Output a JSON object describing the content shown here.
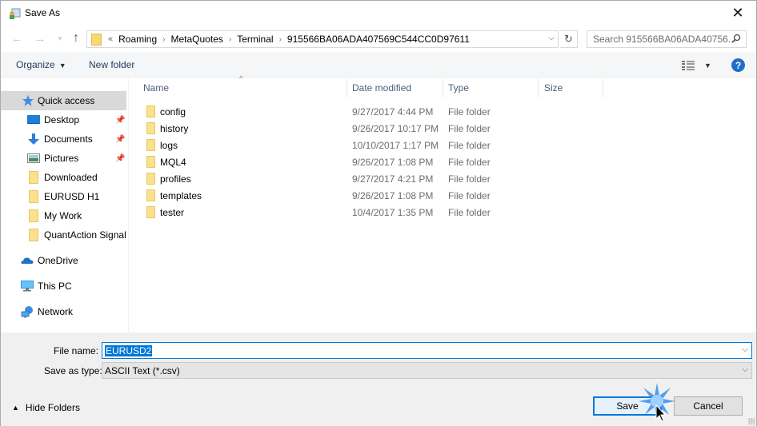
{
  "window": {
    "title": "Save As",
    "close_icon": "close-icon"
  },
  "nav": {
    "back_icon": "arrow-left-icon",
    "forward_icon": "arrow-right-icon",
    "recent_icon": "chevron-down-icon",
    "up_icon": "arrow-up-icon",
    "overflow_glyph": "«",
    "breadcrumbs": [
      "Roaming",
      "MetaQuotes",
      "Terminal",
      "915566BA06ADA407569C544CC0D97611"
    ],
    "search_placeholder": "Search 915566BA06ADA40756..."
  },
  "toolbar": {
    "organize_label": "Organize",
    "new_folder_label": "New folder"
  },
  "sidebar": {
    "items": [
      {
        "label": "Quick access",
        "icon": "star-icon",
        "selected": true
      },
      {
        "label": "Desktop",
        "icon": "desktop-icon",
        "pinned": true
      },
      {
        "label": "Documents",
        "icon": "download-arrow-icon",
        "pinned": true
      },
      {
        "label": "Pictures",
        "icon": "pictures-icon",
        "pinned": true
      },
      {
        "label": "Downloaded",
        "icon": "folder-icon"
      },
      {
        "label": "EURUSD H1",
        "icon": "folder-icon"
      },
      {
        "label": "My Work",
        "icon": "folder-icon"
      },
      {
        "label": "QuantAction Signal",
        "icon": "folder-icon"
      },
      {
        "label": "OneDrive",
        "icon": "cloud-icon"
      },
      {
        "label": "This PC",
        "icon": "computer-icon"
      },
      {
        "label": "Network",
        "icon": "network-icon"
      }
    ]
  },
  "filelist": {
    "columns": [
      "Name",
      "Date modified",
      "Type",
      "Size"
    ],
    "rows": [
      {
        "name": "config",
        "date": "9/27/2017 4:44 PM",
        "type": "File folder",
        "size": ""
      },
      {
        "name": "history",
        "date": "9/26/2017 10:17 PM",
        "type": "File folder",
        "size": ""
      },
      {
        "name": "logs",
        "date": "10/10/2017 1:17 PM",
        "type": "File folder",
        "size": ""
      },
      {
        "name": "MQL4",
        "date": "9/26/2017 1:08 PM",
        "type": "File folder",
        "size": ""
      },
      {
        "name": "profiles",
        "date": "9/27/2017 4:21 PM",
        "type": "File folder",
        "size": ""
      },
      {
        "name": "templates",
        "date": "9/26/2017 1:08 PM",
        "type": "File folder",
        "size": ""
      },
      {
        "name": "tester",
        "date": "10/4/2017 1:35 PM",
        "type": "File folder",
        "size": ""
      }
    ]
  },
  "form": {
    "file_name_label": "File name:",
    "file_name_value": "EURUSD2",
    "save_type_label": "Save as type:",
    "save_type_value": "ASCII Text (*.csv)"
  },
  "footer": {
    "hide_folders_label": "Hide Folders",
    "save_label": "Save",
    "cancel_label": "Cancel"
  },
  "colors": {
    "accent": "#0078d7",
    "folder": "#fbe08d",
    "selected_bg": "#d9d9d9",
    "header_text": "#4c607a"
  }
}
